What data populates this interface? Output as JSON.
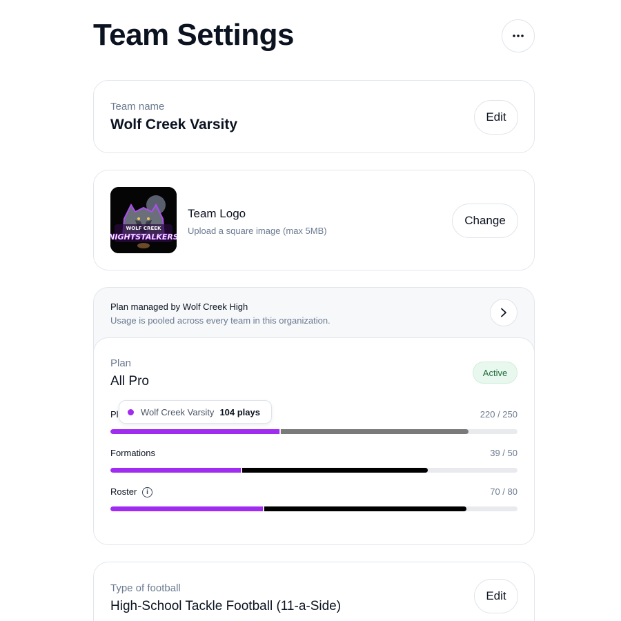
{
  "header": {
    "title": "Team Settings",
    "more_icon": "more-horizontal-icon"
  },
  "team_name": {
    "label": "Team name",
    "value": "Wolf Creek Varsity",
    "edit_label": "Edit"
  },
  "team_logo": {
    "title": "Team Logo",
    "subtitle": "Upload a square image (max 5MB)",
    "change_label": "Change",
    "logo_text_top": "WOLF CREEK",
    "logo_text_main": "NIGHTSTALKERS"
  },
  "plan": {
    "managed_title": "Plan managed by Wolf Creek High",
    "managed_sub": "Usage is pooled across every team in this organization.",
    "label": "Plan",
    "name": "All Pro",
    "status": "Active",
    "meters": [
      {
        "label": "Plays",
        "count": "220 / 250",
        "team_value": 104,
        "other_value": 116,
        "max": 250,
        "other_color": "#7a7a7a"
      },
      {
        "label": "Formations",
        "count": "39 / 50",
        "team_value": 16,
        "other_value": 23,
        "max": 50,
        "other_color": "#000000"
      },
      {
        "label": "Roster",
        "count": "70 / 80",
        "team_value": 30,
        "other_value": 40,
        "max": 80,
        "other_color": "#000000"
      }
    ],
    "tooltip": {
      "team": "Wolf Creek Varsity",
      "value": "104 plays"
    }
  },
  "football": {
    "label": "Type of football",
    "value": "High-School Tackle Football (11-a-Side)",
    "edit_label": "Edit"
  },
  "colors": {
    "team_purple": "#a02cf0",
    "active_green": "#1f6b3a",
    "track": "#e8eaee"
  }
}
